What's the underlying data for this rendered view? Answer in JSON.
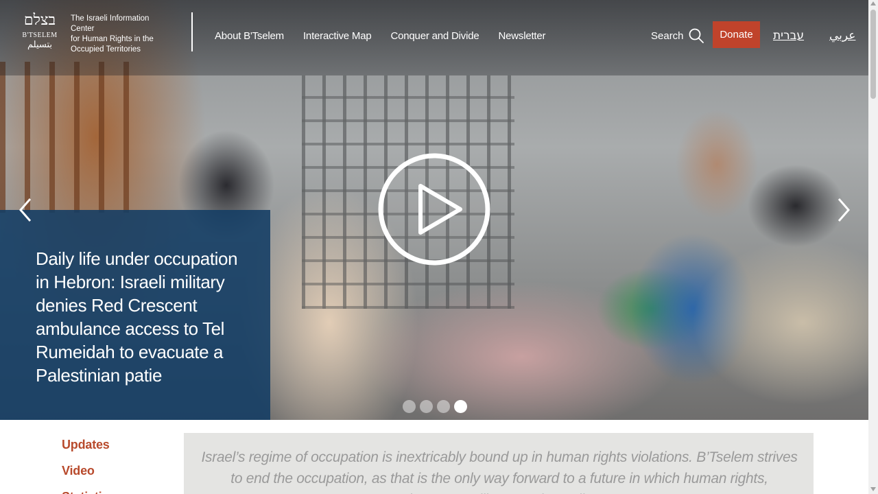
{
  "brand": {
    "logo_hebrew": "בצלם",
    "logo_english": "B'TSELEM",
    "logo_arabic": "بتسيلم",
    "tagline": [
      "The Israeli Information Center",
      "for Human Rights in the",
      "Occupied Territories"
    ]
  },
  "nav": {
    "items": [
      "About B'Tselem",
      "Interactive Map",
      "Conquer and Divide",
      "Newsletter"
    ],
    "search_label": "Search",
    "search_icon": "magnifier-icon",
    "donate_label": "Donate",
    "lang_hebrew": "עברית",
    "lang_arabic": "عربي"
  },
  "hero": {
    "caption": "Daily life under occupation in Hebron: Israeli military denies Red Crescent ambulance access to Tel Rumeidah to evacuate a Palestinian patie",
    "play_icon": "play-icon",
    "prev_icon": "chevron-left-icon",
    "next_icon": "chevron-right-icon",
    "slides_total": 4,
    "active_slide": 4
  },
  "sidebar": {
    "links": [
      "Updates",
      "Video",
      "Statistics"
    ]
  },
  "mission": {
    "text": "Israel’s regime of occupation is inextricably bound up in human rights violations. B’Tselem strives to end the occupation, as that is the only way forward to a future in which human rights, democracy, liberty and equality"
  },
  "colors": {
    "accent": "#c0432b",
    "link": "#b84a2c",
    "caption_bg": "#123c64"
  }
}
